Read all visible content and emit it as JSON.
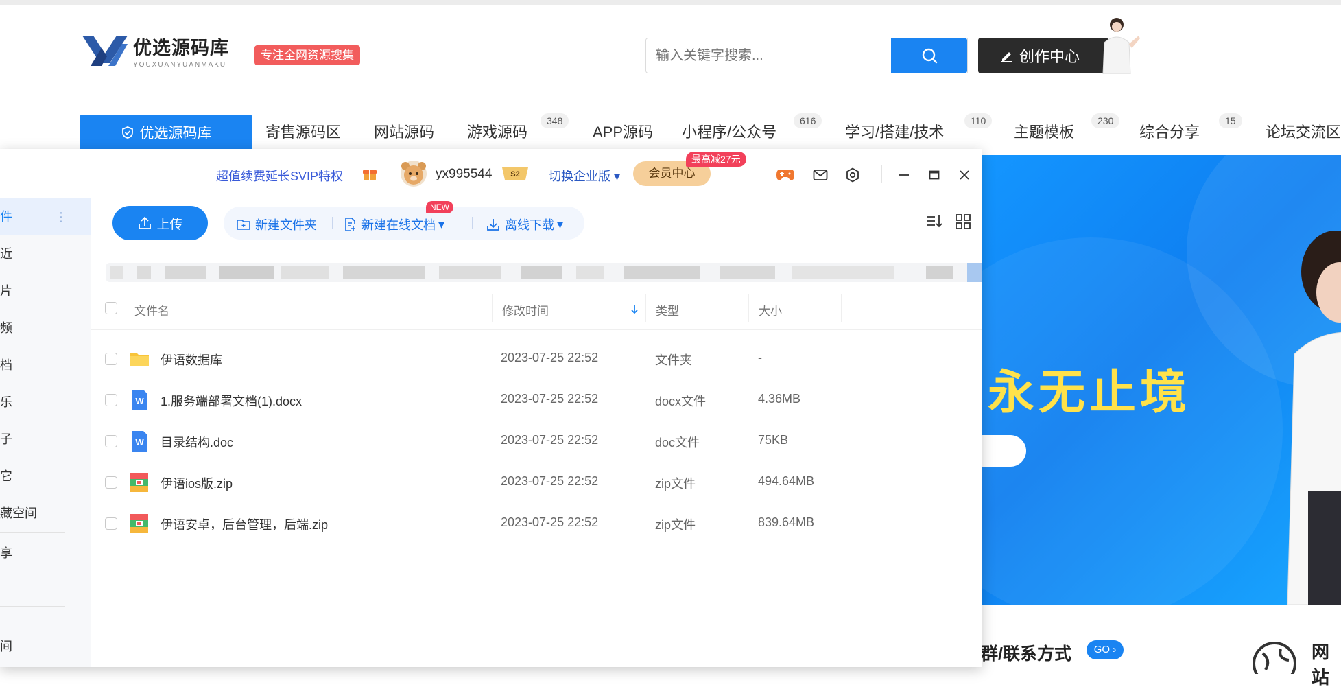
{
  "site": {
    "logo_cn": "优选源码库",
    "logo_en": "YOUXUANYUANMAKU",
    "tag": "专注全网资源搜集",
    "search_placeholder": "输入关键字搜索...",
    "create_label": "创作中心"
  },
  "nav": {
    "home": "优选源码库",
    "items": [
      {
        "label": "寄售源码区",
        "badge": ""
      },
      {
        "label": "网站源码",
        "badge": ""
      },
      {
        "label": "游戏源码",
        "badge": "348"
      },
      {
        "label": "APP源码",
        "badge": ""
      },
      {
        "label": "小程序/公众号",
        "badge": "616"
      },
      {
        "label": "学习/搭建/技术",
        "badge": "110"
      },
      {
        "label": "主题模板",
        "badge": "230"
      },
      {
        "label": "综合分享",
        "badge": "15"
      },
      {
        "label": "论坛交流区",
        "badge": ""
      }
    ]
  },
  "banner": {
    "title": "永无止境",
    "section_left": "群/联系方式",
    "go_label": "GO",
    "section_right": "网站"
  },
  "app": {
    "svip_promo": "超值续费延长SVIP特权",
    "username": "yx995544",
    "enterprise": "切换企业版",
    "member_center": "会员中心",
    "promo_badge": "最高减27元",
    "sidebar": [
      "件",
      "近",
      "片",
      "频",
      "档",
      "乐",
      "子",
      "它",
      "藏空间",
      "享",
      "间"
    ],
    "toolbar": {
      "upload": "上传",
      "new_folder": "新建文件夹",
      "new_doc": "新建在线文档",
      "new_badge": "NEW",
      "offline": "离线下载"
    },
    "columns": {
      "name": "文件名",
      "modified": "修改时间",
      "type": "类型",
      "size": "大小"
    },
    "files": [
      {
        "name": "伊语数据库",
        "modified": "2023-07-25 22:52",
        "type": "文件夹",
        "size": "-",
        "icon": "folder-icon"
      },
      {
        "name": "1.服务端部署文档(1).docx",
        "modified": "2023-07-25 22:52",
        "type": "docx文件",
        "size": "4.36MB",
        "icon": "word-icon"
      },
      {
        "name": "目录结构.doc",
        "modified": "2023-07-25 22:52",
        "type": "doc文件",
        "size": "75KB",
        "icon": "word-icon"
      },
      {
        "name": "伊语ios版.zip",
        "modified": "2023-07-25 22:52",
        "type": "zip文件",
        "size": "494.64MB",
        "icon": "zip-icon"
      },
      {
        "name": "伊语安卓，后台管理，后端.zip",
        "modified": "2023-07-25 22:52",
        "type": "zip文件",
        "size": "839.64MB",
        "icon": "zip-icon"
      }
    ]
  },
  "colors": {
    "accent": "#1a84f2",
    "banner_title": "#ffe24a",
    "tag": "#f25c5c",
    "promo": "#f2405a"
  }
}
